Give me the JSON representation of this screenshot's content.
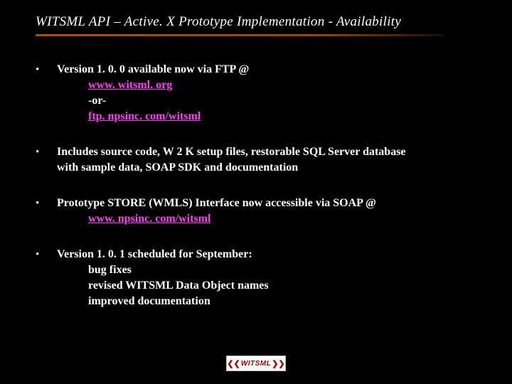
{
  "title": "WITSML API – Active. X Prototype Implementation - Availability",
  "b1": {
    "lead": "Version 1. 0. 0 available now via FTP @",
    "link1": "www. witsml. org",
    "or": "-or-",
    "link2": "ftp. npsinc. com/witsml"
  },
  "b2": {
    "line1": "Includes source code, W 2 K setup files, restorable SQL Server database",
    "line2": " with sample data, SOAP SDK and documentation"
  },
  "b3": {
    "lead": "Prototype STORE (WMLS) Interface now accessible via SOAP @",
    "link": "www. npsinc. com/witsml"
  },
  "b4": {
    "lead": "Version 1. 0. 1 scheduled for September:",
    "s1": "bug fixes",
    "s2": "revised WITSML Data Object names",
    "s3": "improved documentation"
  },
  "logo": "WITSML"
}
